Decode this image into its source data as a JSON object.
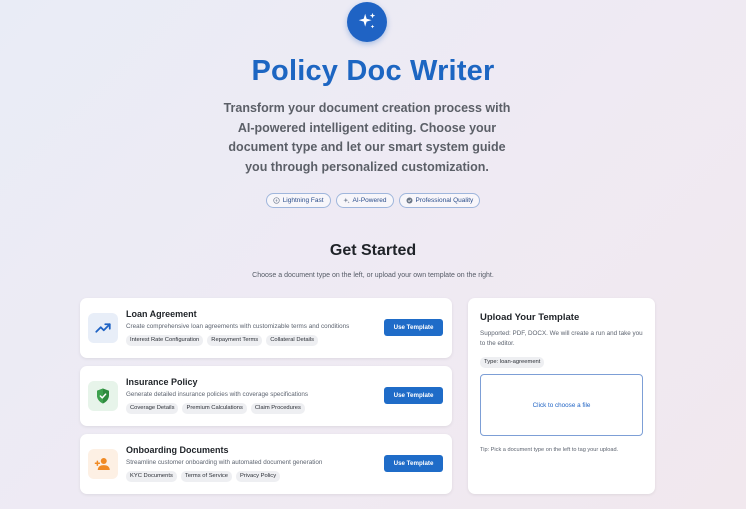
{
  "hero": {
    "icon": "sparkles-icon",
    "title": "Policy Doc Writer",
    "subtitle": "Transform your document creation process with AI-powered intelligent editing. Choose your document type and let our smart system guide you through personalized customization.",
    "badges": [
      {
        "icon": "lightning-icon",
        "label": "Lightning Fast"
      },
      {
        "icon": "sparkles-icon",
        "label": "AI-Powered"
      },
      {
        "icon": "check-circle-icon",
        "label": "Professional Quality"
      }
    ]
  },
  "get_started": {
    "title": "Get Started",
    "subtitle": "Choose a document type on the left, or upload your own template on the right."
  },
  "documents": [
    {
      "icon": "trending-up-icon",
      "title": "Loan Agreement",
      "description": "Create comprehensive loan agreements with customizable terms and conditions",
      "tags": [
        "Interest Rate Configuration",
        "Repayment Terms",
        "Collateral Details"
      ],
      "button": "Use Template"
    },
    {
      "icon": "shield-check-icon",
      "title": "Insurance Policy",
      "description": "Generate detailed insurance policies with coverage specifications",
      "tags": [
        "Coverage Details",
        "Premium Calculations",
        "Claim Procedures"
      ],
      "button": "Use Template"
    },
    {
      "icon": "person-add-icon",
      "title": "Onboarding Documents",
      "description": "Streamline customer onboarding with automated document generation",
      "tags": [
        "KYC Documents",
        "Terms of Service",
        "Privacy Policy"
      ],
      "button": "Use Template"
    }
  ],
  "upload": {
    "title": "Upload Your Template",
    "description": "Supported: PDF, DOCX. We will create a run and take you to the editor.",
    "type_tag": "Type: loan-agreement",
    "dropzone_label": "Click to choose a file",
    "tip": "Tip: Pick a document type on the left to tag your upload."
  },
  "colors": {
    "primary": "#1f6cc8",
    "title": "#1d66c2",
    "loan_icon_bg": "#e8eef8",
    "insurance_icon_bg": "#e7f4ea",
    "onboarding_icon_bg": "#fdf0e4"
  }
}
